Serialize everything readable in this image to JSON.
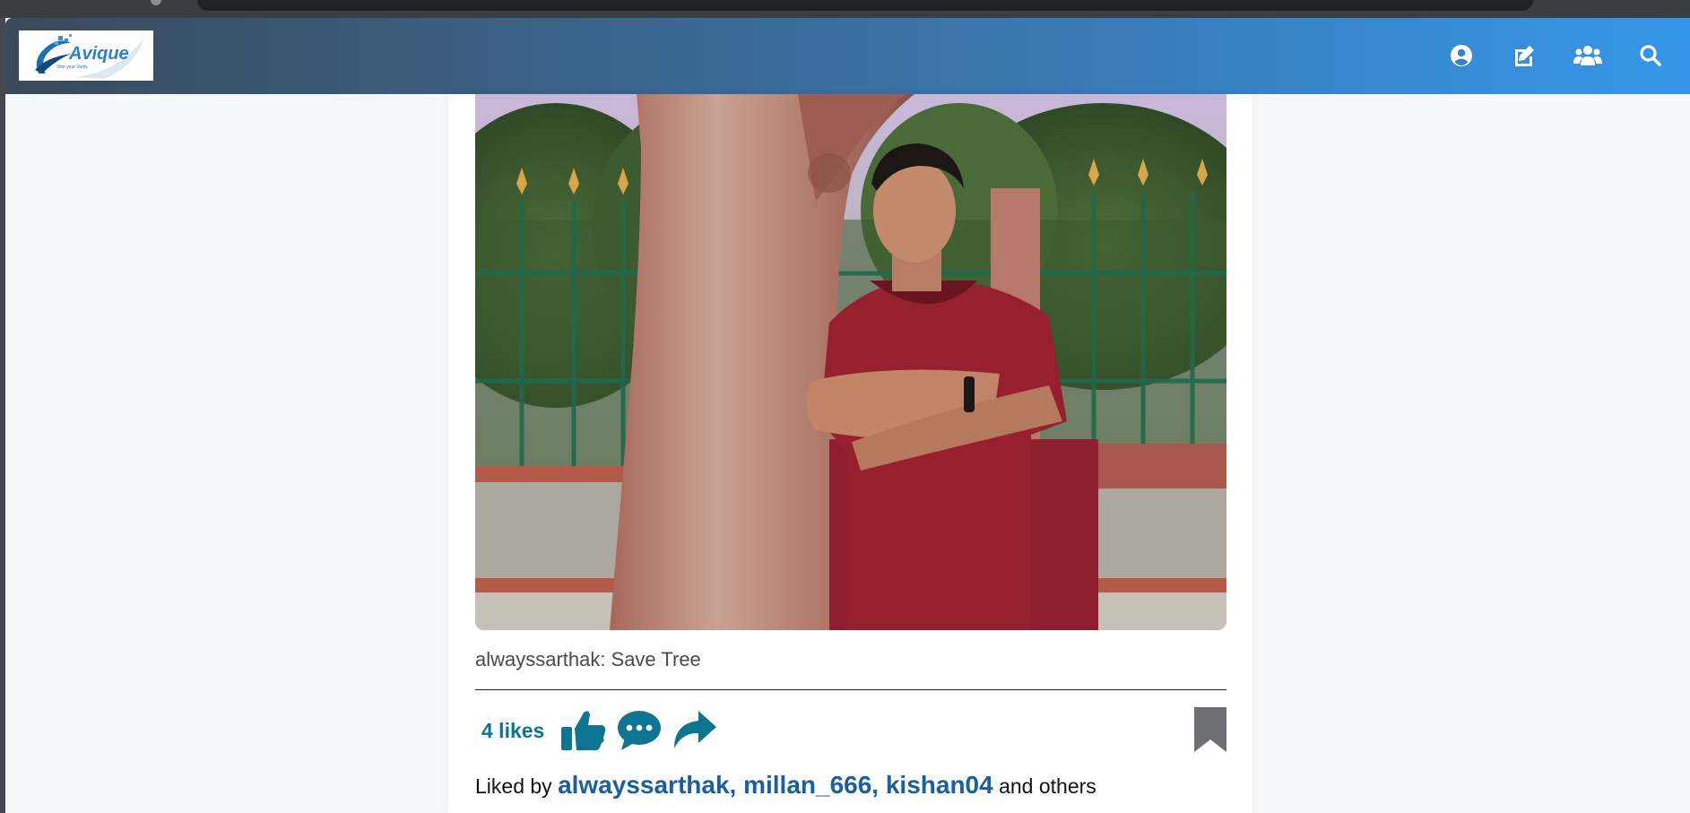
{
  "navbar": {
    "logo_text": "Avique",
    "logo_tagline": "Vibe your Verity",
    "icons": [
      "user-circle-icon",
      "edit-icon",
      "users-icon",
      "search-icon"
    ],
    "gradient_colors": [
      "#3a4a5a",
      "#3697ea"
    ]
  },
  "post": {
    "caption_user": "alwayssarthak:",
    "caption_text": "Save Tree",
    "likes_label": "4 likes",
    "liked_by_prefix": "Liked by",
    "liked_by_names": "alwayssarthak, millan_666, kishan04",
    "liked_by_suffix": "and others",
    "action_icons": [
      "thumbs-up-icon",
      "comment-icon",
      "share-icon",
      "bookmark-icon"
    ],
    "accent_color": "#0d7491"
  }
}
